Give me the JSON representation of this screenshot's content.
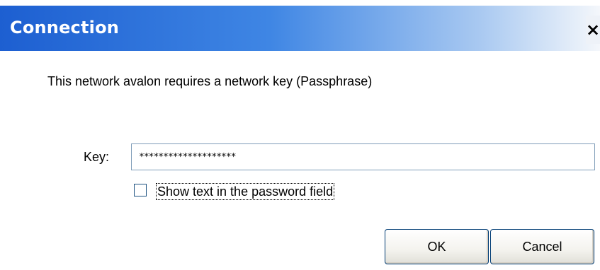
{
  "window": {
    "title": "Connection",
    "close_icon": "close-icon",
    "close_glyph": "×"
  },
  "message": "This network avalon requires a network key (Passphrase)",
  "key": {
    "label": "Key:",
    "value": "********************"
  },
  "show_text": {
    "label": "Show text in the password field",
    "checked": false
  },
  "buttons": {
    "ok": "OK",
    "cancel": "Cancel"
  },
  "colors": {
    "titlebar_start": "#1d5fd1",
    "titlebar_end": "#f4f7fb",
    "input_border": "#7f9db9",
    "button_border": "#003c74"
  }
}
